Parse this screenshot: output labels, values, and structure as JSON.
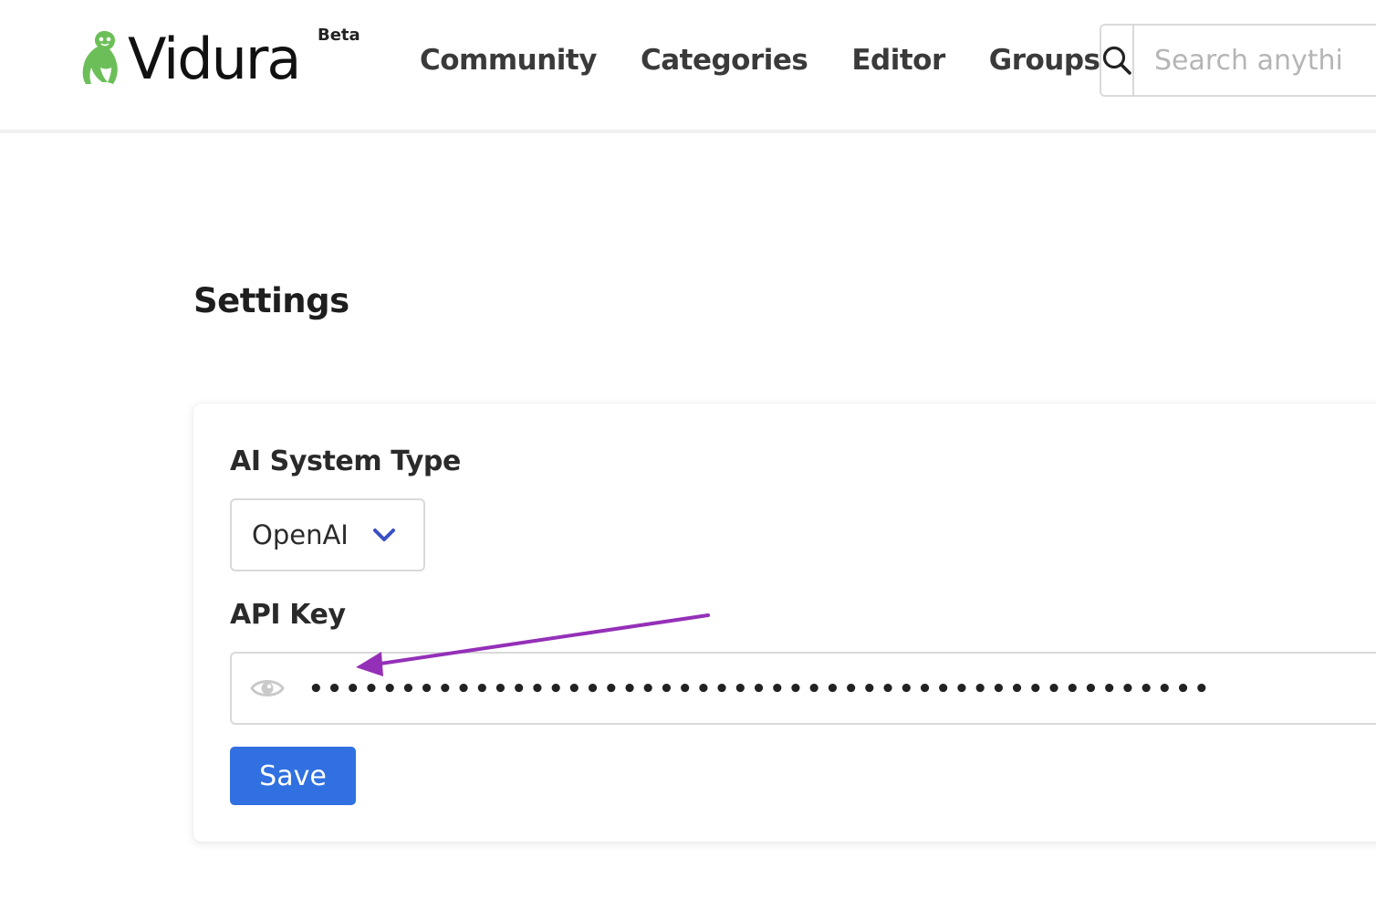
{
  "header": {
    "logo_text": "Vidura",
    "logo_badge": "Beta",
    "nav": [
      {
        "label": "Community"
      },
      {
        "label": "Categories"
      },
      {
        "label": "Editor"
      },
      {
        "label": "Groups"
      }
    ],
    "search": {
      "placeholder": "Search anythi",
      "icon": "search-icon"
    }
  },
  "page": {
    "title": "Settings"
  },
  "settings_form": {
    "ai_system_label": "AI System Type",
    "ai_system_value": "OpenAI",
    "api_key_label": "API Key",
    "api_key_masked": "•••••••••••••••••••••••••••••••••••••••••••••••••",
    "save_label": "Save"
  },
  "colors": {
    "brand_green": "#6cbf58",
    "primary_button": "#3070e0",
    "chevron": "#3b4fc4",
    "annotation_arrow": "#9430b8"
  }
}
